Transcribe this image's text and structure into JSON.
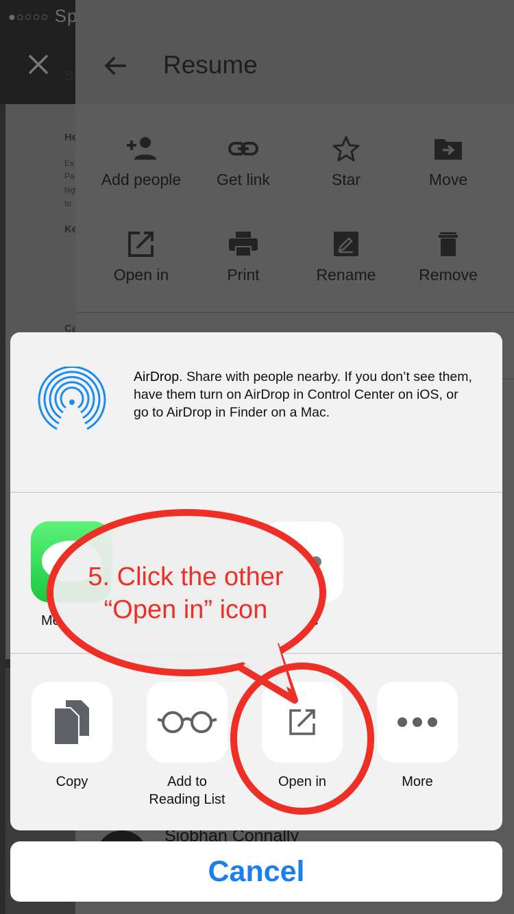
{
  "status_bar": {
    "signal": "●○○○○",
    "carrier": "Sp"
  },
  "background_doc": {
    "heading_1": "S",
    "heading_2": "He",
    "lines": [
      "Ex",
      "Pa",
      "hig",
      "to"
    ],
    "heading_3": "Ke",
    "heading_4": "Ca"
  },
  "panel": {
    "title": "Resume",
    "actions": [
      {
        "label": "Add people",
        "icon": "add-person-icon"
      },
      {
        "label": "Get link",
        "icon": "link-icon"
      },
      {
        "label": "Star",
        "icon": "star-icon"
      },
      {
        "label": "Move",
        "icon": "move-folder-icon"
      },
      {
        "label": "Open in",
        "icon": "open-in-icon"
      },
      {
        "label": "Print",
        "icon": "print-icon"
      },
      {
        "label": "Rename",
        "icon": "rename-icon"
      },
      {
        "label": "Remove",
        "icon": "trash-icon"
      }
    ]
  },
  "share_sheet": {
    "airdrop": {
      "title": "AirDrop",
      "description": ". Share with people nearby. If you don’t see them, have them turn on AirDrop in Control Center on iOS, or go to AirDrop in Finder on a Mac."
    },
    "apps": [
      {
        "label": "Me",
        "icon": "messages-icon"
      },
      {
        "label": "e",
        "icon": "app-icon"
      }
    ],
    "actions": [
      {
        "label": "Copy",
        "icon": "copy-icon"
      },
      {
        "label": "Add to\nReading List",
        "label_line1": "Add to",
        "label_line2": "Reading List",
        "icon": "glasses-icon"
      },
      {
        "label": "Open in",
        "icon": "open-in-icon"
      },
      {
        "label": "More",
        "icon": "more-icon"
      }
    ],
    "cancel_label": "Cancel"
  },
  "behind_sheet": {
    "contact_name": "Siobhan Connally"
  },
  "annotation": {
    "line1": "5. Click the other",
    "line2": "“Open in” icon",
    "color": "#ee2f25"
  },
  "colors": {
    "accent": "#1a7ff0",
    "annotation": "#ee2f25",
    "airdrop": "#1a8cf0"
  }
}
